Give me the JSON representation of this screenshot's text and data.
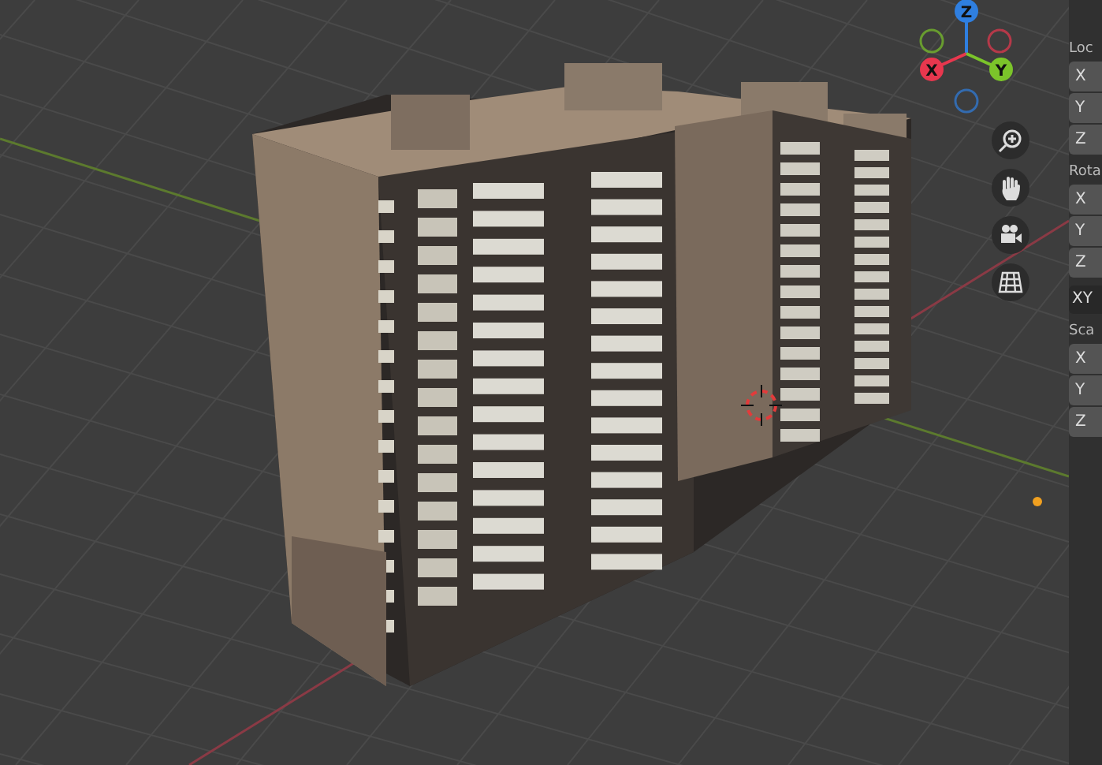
{
  "gizmo": {
    "axes": [
      {
        "label": "Z",
        "kind": "z",
        "color": "#2f7fe0"
      },
      {
        "label": "X",
        "kind": "x",
        "color": "#e8374e"
      },
      {
        "label": "Y",
        "kind": "y",
        "color": "#7bc42a"
      }
    ]
  },
  "sidebar": {
    "sections": [
      {
        "label": "Loc",
        "fields": [
          "X",
          "Y",
          "Z"
        ]
      },
      {
        "label": "Rota",
        "fields": [
          "X",
          "Y",
          "Z"
        ],
        "mode": "XY"
      },
      {
        "label": "Sca",
        "fields": [
          "X",
          "Y",
          "Z"
        ]
      }
    ]
  }
}
